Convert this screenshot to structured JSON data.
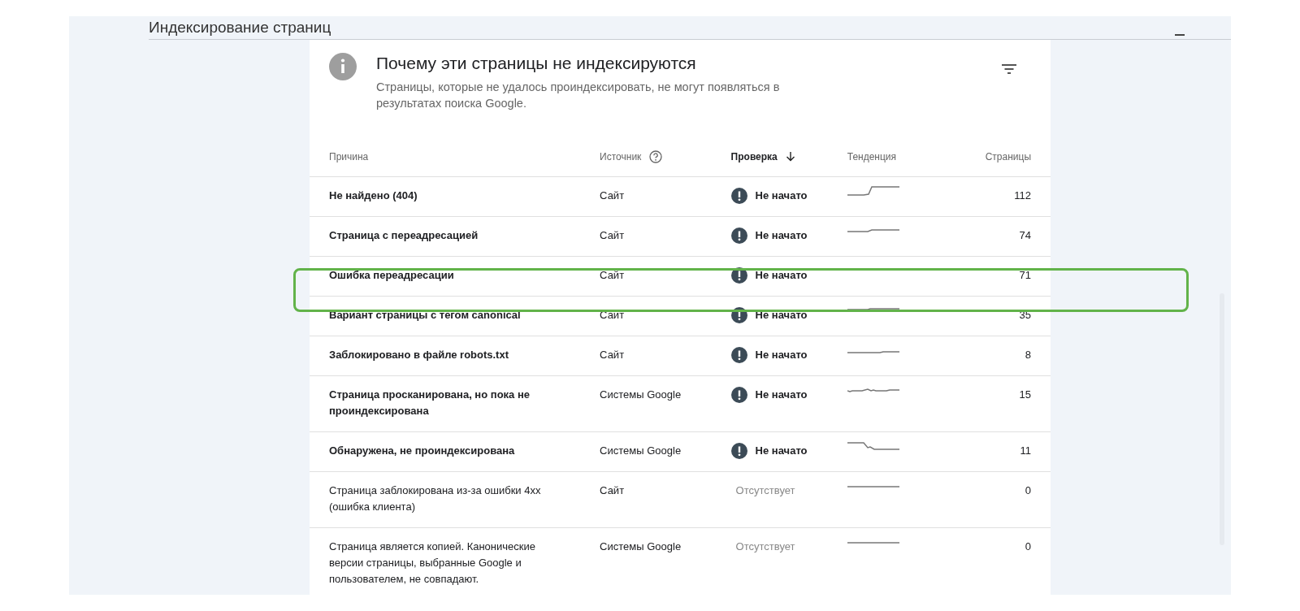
{
  "page": {
    "title": "Индексирование страниц"
  },
  "card": {
    "title": "Почему эти страницы не индексируются",
    "description": "Страницы, которые не удалось проиндексировать, не могут появляться в результатах поиска Google."
  },
  "table": {
    "columns": [
      {
        "label": "Причина",
        "kind": "text",
        "sorted": false
      },
      {
        "label": "Источник",
        "kind": "help",
        "sorted": false
      },
      {
        "label": "Проверка",
        "kind": "text",
        "sorted": true
      },
      {
        "label": "Тенденция",
        "kind": "text",
        "sorted": false
      },
      {
        "label": "Страницы",
        "kind": "number",
        "sorted": false
      }
    ],
    "rows": [
      {
        "reason": "Не найдено (404)",
        "source": "Сайт",
        "status": "Не начато",
        "kind": "warning",
        "pages": "112"
      },
      {
        "reason": "Страница с переадресацией",
        "source": "Сайт",
        "status": "Не начато",
        "kind": "warning",
        "pages": "74"
      },
      {
        "reason": "Ошибка переадресации",
        "source": "Сайт",
        "status": "Не начато",
        "kind": "warning",
        "pages": "71"
      },
      {
        "reason": "Вариант страницы с тегом canonical",
        "source": "Сайт",
        "status": "Не начато",
        "kind": "warning",
        "pages": "35"
      },
      {
        "reason": "Заблокировано в файле robots.txt",
        "source": "Сайт",
        "status": "Не начато",
        "kind": "warning",
        "pages": "8"
      },
      {
        "reason": "Страница просканирована, но пока не проиндексирована",
        "source": "Системы Google",
        "status": "Не начато",
        "kind": "warning",
        "pages": "15"
      },
      {
        "reason": "Обнаружена, не проиндексирована",
        "source": "Системы Google",
        "status": "Не начато",
        "kind": "warning",
        "pages": "11"
      },
      {
        "reason": "Страница заблокирована из-за ошибки 4xx (ошибка клиента)",
        "source": "Сайт",
        "status": "Отсутствует",
        "kind": "plain",
        "pages": "0"
      },
      {
        "reason": "Страница является копией. Канонические версии страницы, выбранные Google и пользователем, не совпадают.",
        "source": "Системы Google",
        "status": "Отсутствует",
        "kind": "plain",
        "pages": "0"
      }
    ]
  }
}
